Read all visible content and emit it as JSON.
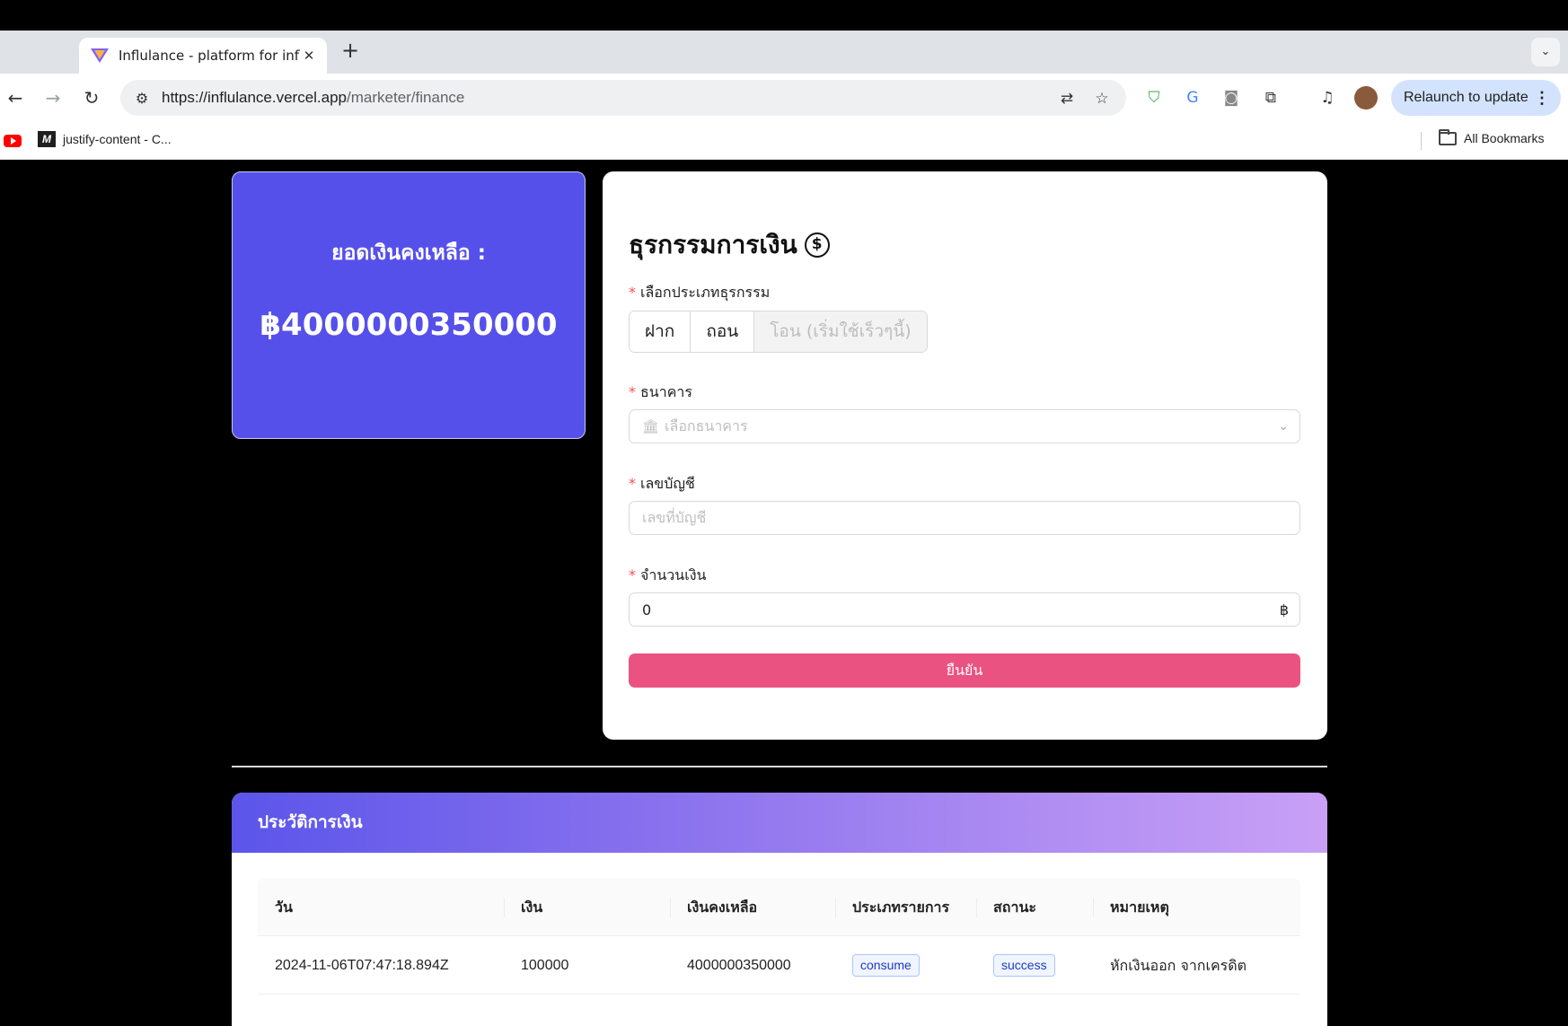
{
  "browser": {
    "tab_title": "Influlance - platform for influe",
    "url_host": "https://influlance.vercel.app",
    "url_path": "/marketer/finance",
    "relaunch_label": "Relaunch to update",
    "bookmark_label": "justify-content - C...",
    "all_bookmarks_label": "All Bookmarks",
    "icons": [
      "back-icon",
      "forward-icon",
      "reload-icon",
      "tune-icon",
      "translate-icon",
      "star-icon",
      "shield-icon",
      "google-translate-icon",
      "camera-icon",
      "extensions-icon",
      "media-icon",
      "avatar",
      "menu-icon"
    ]
  },
  "balance": {
    "label": "ยอดเงินคงเหลือ :",
    "value": "฿4000000350000"
  },
  "finance_form": {
    "title": "ธุรกรรมการเงิน",
    "type_label": "เลือกประเภทธุรกรรม",
    "types": [
      "ฝาก",
      "ถอน",
      "โอน (เริ่มใช้เร็วๆนี้)"
    ],
    "bank_label": "ธนาคาร",
    "bank_placeholder": "เลือกธนาคาร",
    "account_label": "เลขบัญชี",
    "account_placeholder": "เลขที่บัญชี",
    "amount_label": "จำนวนเงิน",
    "amount_value": "0",
    "amount_suffix": "฿",
    "submit_label": "ยืนยัน",
    "colors": {
      "submit": "#ea5381",
      "balance_card": "#5650ea"
    }
  },
  "history": {
    "title": "ประวัติการเงิน",
    "columns": [
      "วัน",
      "เงิน",
      "เงินคงเหลือ",
      "ประเภทรายการ",
      "สถานะ",
      "หมายเหตุ"
    ],
    "rows": [
      {
        "date": "2024-11-06T07:47:18.894Z",
        "amount": "100000",
        "balance": "4000000350000",
        "type": "consume",
        "status": "success",
        "note": "หักเงินออก จากเครดิต"
      }
    ]
  }
}
